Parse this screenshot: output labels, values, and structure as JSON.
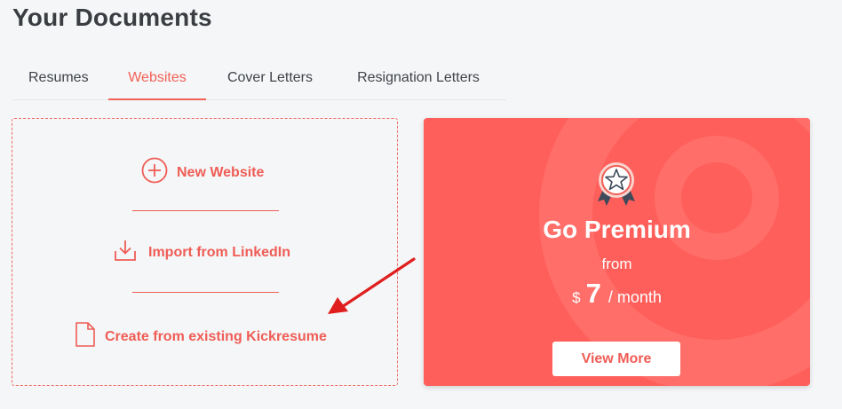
{
  "page": {
    "title": "Your Documents"
  },
  "tabs": [
    {
      "label": "Resumes",
      "active": false
    },
    {
      "label": "Websites",
      "active": true
    },
    {
      "label": "Cover Letters",
      "active": false
    },
    {
      "label": "Resignation Letters",
      "active": false
    }
  ],
  "create_box": {
    "new_website": {
      "label": "New Website",
      "icon": "plus-circle-icon"
    },
    "import_linkedin": {
      "label": "Import from LinkedIn",
      "icon": "download-icon"
    },
    "from_existing": {
      "label": "Create from existing Kickresume",
      "icon": "document-icon"
    }
  },
  "premium": {
    "title": "Go Premium",
    "from": "from",
    "currency": "$",
    "amount": "7",
    "period": "/ month",
    "button_label": "View More",
    "badge_icon": "award-badge-icon"
  },
  "colors": {
    "accent": "#f26158",
    "premium_bg": "#ff5f5a",
    "annotation_arrow": "#e01e1e"
  }
}
